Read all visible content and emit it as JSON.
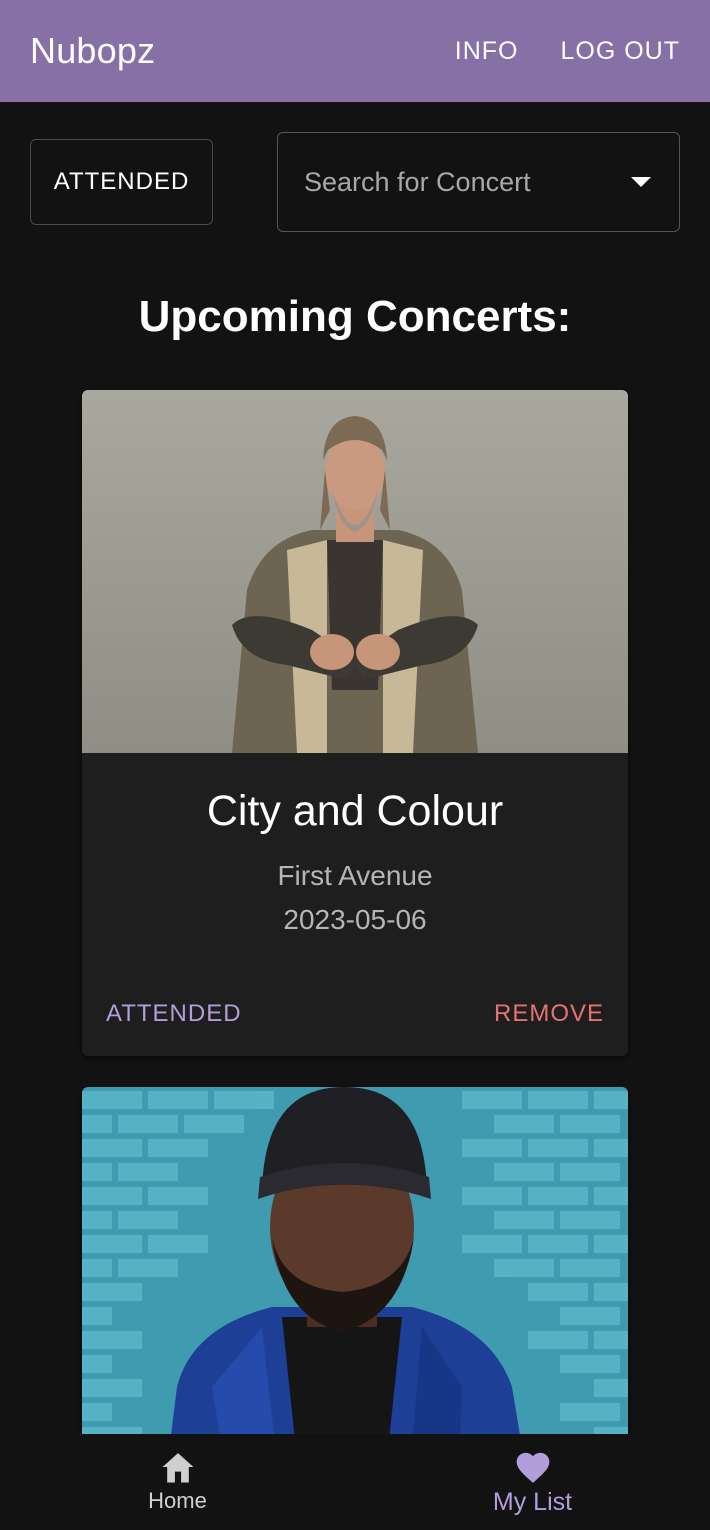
{
  "appbar": {
    "brand": "Nubopz",
    "info_label": "INFO",
    "logout_label": "LOG OUT"
  },
  "controls": {
    "attended_label": "ATTENDED",
    "search_placeholder": "Search for Concert",
    "search_icon": "chevron-down-icon"
  },
  "section": {
    "title": "Upcoming Concerts:"
  },
  "concerts": [
    {
      "artist": "City and Colour",
      "venue": "First Avenue",
      "date": "2023-05-06",
      "attended_label": "ATTENDED",
      "remove_label": "REMOVE"
    },
    {
      "photo": "artist-photo-brick-wall"
    }
  ],
  "bottom_nav": {
    "items": [
      {
        "label": "Home",
        "icon": "home-icon"
      },
      {
        "label": "My List",
        "icon": "heart-icon",
        "active": true
      }
    ]
  },
  "colors": {
    "appbar": "#8670a6",
    "accent": "#b39ddb",
    "danger": "#e57373",
    "background": "#121212",
    "card": "#1e1e1e"
  }
}
